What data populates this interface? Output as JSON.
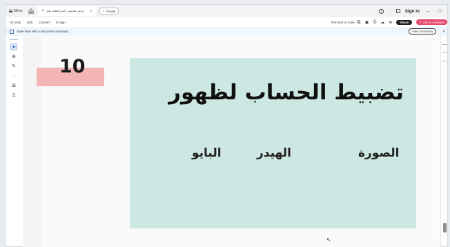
{
  "tabbar": {
    "menu_label": "Menu",
    "doc_tab_title": "عرض تقديمي استراتيجية نمو",
    "create_label": "Create",
    "signin_label": "Sign in",
    "help_glyph": "?",
    "minimize_glyph": "–",
    "maximize_glyph": "□"
  },
  "toolbar": {
    "items": [
      "All tools",
      "Edit",
      "Convert",
      "E-Sign"
    ],
    "find_label": "Find text or tools",
    "share_label": "Share",
    "ai_label": "Ask AI Assistant"
  },
  "banner": {
    "text": "Save time with a document summary",
    "view_summary_label": "View Summary",
    "close_glyph": "×"
  },
  "document": {
    "page_number": "10",
    "slide_title": "تضبيط الحساب لظهور",
    "items": [
      "الصورة",
      "الهيدر",
      "البايو"
    ]
  },
  "colors": {
    "slide_bg": "#cde8e2",
    "number_box": "#f3b5b4",
    "ai_button": "#e5496c",
    "banner_bg": "#eef5fd"
  },
  "icons": {
    "rail": [
      "cursor-select-icon",
      "zoom-icon",
      "pen-icon",
      "eraser-icon",
      "text-box-icon",
      "stamp-icon"
    ]
  }
}
